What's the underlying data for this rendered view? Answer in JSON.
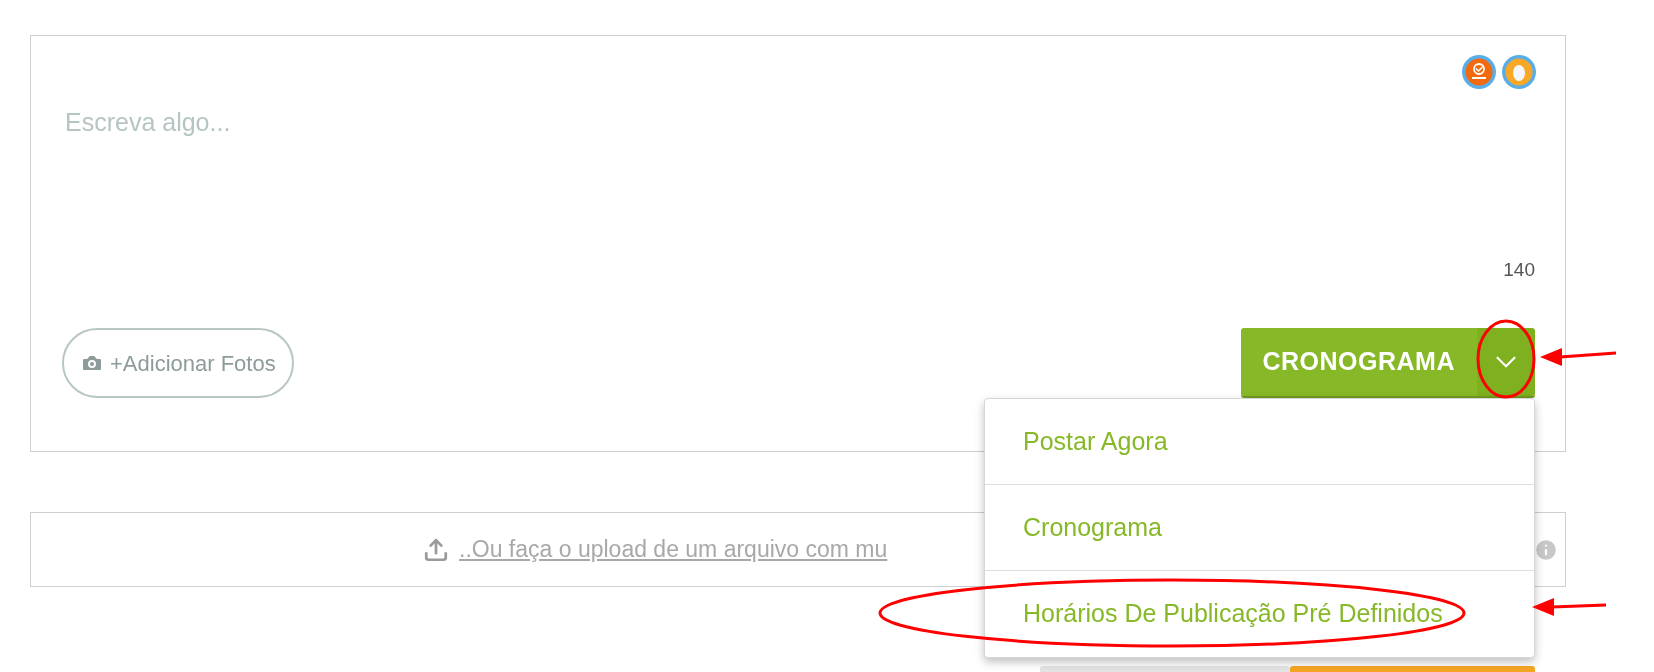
{
  "composer": {
    "placeholder": "Escreva algo...",
    "counter": "140",
    "add_photos": "+Adicionar Fotos",
    "schedule_button": "CRONOGRAMA"
  },
  "dropdown": {
    "expanded": true,
    "items": [
      {
        "label": "Postar Agora"
      },
      {
        "label": "Cronograma"
      },
      {
        "label": "Horários De Publicação Pré Definidos"
      }
    ]
  },
  "upload": {
    "link": "..Ou faça o upload de um arquivo com mu"
  }
}
